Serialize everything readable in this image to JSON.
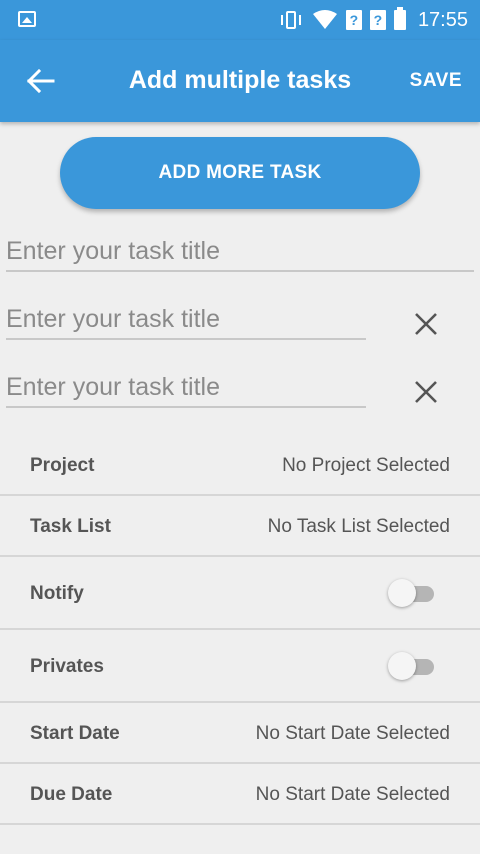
{
  "status_bar": {
    "time": "17:55",
    "icons": [
      "image-icon",
      "vibrate-icon",
      "wifi-icon",
      "signal-unknown-icon",
      "signal-unknown-icon",
      "battery-icon"
    ]
  },
  "app_bar": {
    "title": "Add multiple tasks",
    "save_label": "SAVE",
    "back_icon": "arrow-back-icon",
    "color": "#3a97da"
  },
  "add_more_label": "ADD MORE TASK",
  "tasks": [
    {
      "placeholder": "Enter your task title",
      "value": "",
      "removable": false
    },
    {
      "placeholder": "Enter your task title",
      "value": "",
      "removable": true
    },
    {
      "placeholder": "Enter your task title",
      "value": "",
      "removable": true
    }
  ],
  "settings": {
    "project": {
      "label": "Project",
      "value": "No Project Selected"
    },
    "task_list": {
      "label": "Task List",
      "value": "No Task List Selected"
    },
    "notify": {
      "label": "Notify",
      "enabled": false
    },
    "privates": {
      "label": "Privates",
      "enabled": false
    },
    "start_date": {
      "label": "Start Date",
      "value": "No Start Date Selected"
    },
    "due_date": {
      "label": "Due Date",
      "value": "No Start Date Selected"
    }
  }
}
